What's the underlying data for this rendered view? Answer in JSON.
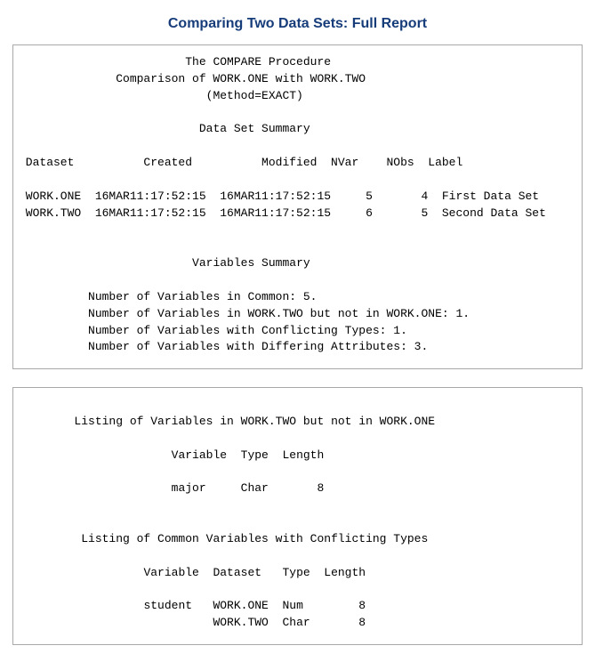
{
  "title": "Comparing Two Data Sets: Full Report",
  "panel1": {
    "header_line1": "The COMPARE Procedure",
    "header_line2": "Comparison of WORK.ONE with WORK.TWO",
    "header_line3": "(Method=EXACT)",
    "section1_title": "Data Set Summary",
    "table_header": " Dataset          Created          Modified  NVar    NObs  Label",
    "table_row1": " WORK.ONE  16MAR11:17:52:15  16MAR11:17:52:15     5       4  First Data Set",
    "table_row2": " WORK.TWO  16MAR11:17:52:15  16MAR11:17:52:15     6       5  Second Data Set",
    "section2_title": "Variables Summary",
    "vars_line1": "Number of Variables in Common: 5.",
    "vars_line2": "Number of Variables in WORK.TWO but not in WORK.ONE: 1.",
    "vars_line3": "Number of Variables with Conflicting Types: 1.",
    "vars_line4": "Number of Variables with Differing Attributes: 3."
  },
  "panel2": {
    "section1_title": "Listing of Variables in WORK.TWO but not in WORK.ONE",
    "section1_header": "Variable  Type  Length",
    "section1_row": "major     Char       8",
    "section2_title": "Listing of Common Variables with Conflicting Types",
    "section2_header": "Variable  Dataset   Type  Length",
    "section2_row1": "student   WORK.ONE  Num        8",
    "section2_row2": "          WORK.TWO  Char       8"
  }
}
